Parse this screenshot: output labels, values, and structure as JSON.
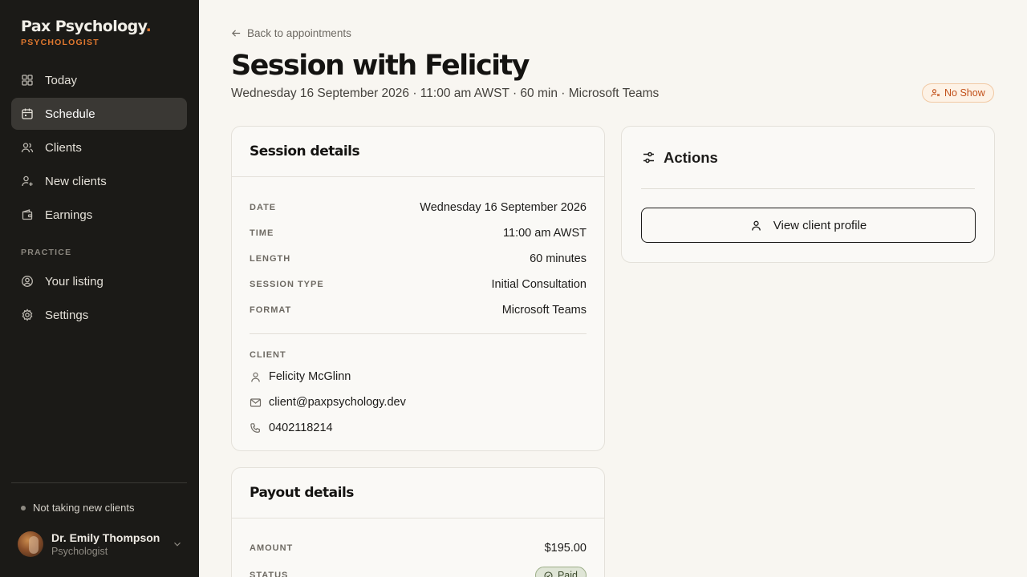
{
  "brand": {
    "name": "Pax Psychology",
    "dot": ".",
    "role": "PSYCHOLOGIST",
    "accent_color": "#e0782f"
  },
  "sidebar": {
    "items": [
      {
        "label": "Today",
        "icon": "grid-icon"
      },
      {
        "label": "Schedule",
        "icon": "calendar-icon",
        "active": true
      },
      {
        "label": "Clients",
        "icon": "users-icon"
      },
      {
        "label": "New clients",
        "icon": "user-plus-icon"
      },
      {
        "label": "Earnings",
        "icon": "wallet-icon"
      }
    ],
    "section_label": "PRACTICE",
    "practice_items": [
      {
        "label": "Your listing",
        "icon": "user-circle-icon"
      },
      {
        "label": "Settings",
        "icon": "gear-icon"
      }
    ],
    "availability_status": "Not taking new clients",
    "user": {
      "name": "Dr. Emily Thompson",
      "role": "Psychologist"
    }
  },
  "header": {
    "back_label": "Back to appointments",
    "title": "Session with Felicity",
    "subtitle": "Wednesday 16 September 2026 · 11:00 am AWST · 60 min · Microsoft Teams",
    "status_badge": "No Show"
  },
  "session_details": {
    "title": "Session details",
    "rows": [
      {
        "label": "DATE",
        "value": "Wednesday 16 September 2026"
      },
      {
        "label": "TIME",
        "value": "11:00 am AWST"
      },
      {
        "label": "LENGTH",
        "value": "60 minutes"
      },
      {
        "label": "SESSION TYPE",
        "value": "Initial Consultation"
      },
      {
        "label": "FORMAT",
        "value": "Microsoft Teams"
      }
    ],
    "client_label": "CLIENT",
    "client": {
      "name": "Felicity McGlinn",
      "email": "client@paxpsychology.dev",
      "phone": "0402118214"
    }
  },
  "actions": {
    "title": "Actions",
    "view_profile_label": "View client profile"
  },
  "payout_details": {
    "title": "Payout details",
    "amount_label": "AMOUNT",
    "amount_value": "$195.00",
    "status_label": "STATUS",
    "status_value": "Paid"
  }
}
